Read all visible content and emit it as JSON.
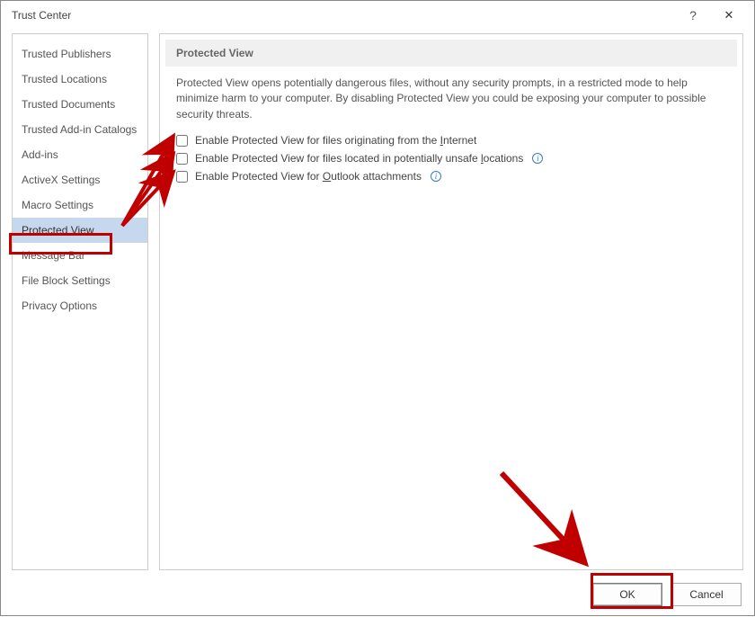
{
  "window": {
    "title": "Trust Center"
  },
  "sidebar": {
    "items": [
      {
        "label": "Trusted Publishers"
      },
      {
        "label": "Trusted Locations"
      },
      {
        "label": "Trusted Documents"
      },
      {
        "label": "Trusted Add-in Catalogs"
      },
      {
        "label": "Add-ins"
      },
      {
        "label": "ActiveX Settings"
      },
      {
        "label": "Macro Settings"
      },
      {
        "label": "Protected View"
      },
      {
        "label": "Message Bar"
      },
      {
        "label": "File Block Settings"
      },
      {
        "label": "Privacy Options"
      }
    ],
    "selected_index": 7
  },
  "section": {
    "header": "Protected View",
    "description": "Protected View opens potentially dangerous files, without any security prompts, in a restricted mode to help minimize harm to your computer. By disabling Protected View you could be exposing your computer to possible security threats.",
    "options": [
      {
        "pre": "Enable Protected View for files originating from the ",
        "m": "I",
        "post": "nternet",
        "checked": false,
        "info": false
      },
      {
        "pre": "Enable Protected View for files located in potentially unsafe ",
        "m": "l",
        "post": "ocations",
        "checked": false,
        "info": true
      },
      {
        "pre": "Enable Protected View for ",
        "m": "O",
        "post": "utlook attachments",
        "checked": false,
        "info": true
      }
    ]
  },
  "footer": {
    "ok": "OK",
    "cancel": "Cancel"
  },
  "icons": {
    "help": "?",
    "close": "✕",
    "info": "i"
  }
}
